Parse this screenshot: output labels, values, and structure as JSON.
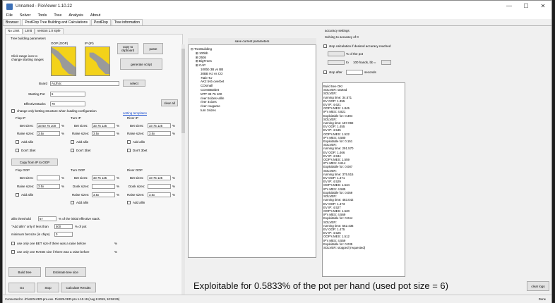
{
  "window": {
    "title": "Unnamed - PioViewer 1.10.22",
    "controls": [
      "—",
      "☐",
      "✕"
    ]
  },
  "menu": [
    "File",
    "Solver",
    "Tools",
    "Tree",
    "Analysis",
    "About"
  ],
  "main_tabs": [
    "Browser",
    "PostFlop Tree Building and Calculations",
    "PostFlop",
    "Tree information"
  ],
  "sub_tabs": [
    "No Limit",
    "Limit",
    "version 1.0 style"
  ],
  "left": {
    "section_title": "Tree building parameters",
    "oop_label": "OOP (OOP)",
    "ip_label": "IP (IP)",
    "range_hint": "Click range icon to change starting ranges",
    "copy_clipboard": "copy to clipboard",
    "paste": "paste",
    "generate_script": "generate script",
    "board_label": "Board",
    "board_value": "AsJh4c",
    "select": "select",
    "starting_pot_label": "Starting Pot",
    "starting_pot_value": "6",
    "eff_stacks_label": "EffectiveStacks",
    "eff_stacks_value": "70",
    "clear_all": "clear all",
    "change_only_label": "change only betting structure when loading configuration",
    "setting_templates": "setting templates",
    "flop_ip": "Flop IP",
    "turn_ip": "Turn IP",
    "river_ip": "River IP",
    "bet_sizes": "Bet sizes:",
    "raise_sizes": "Raise sizes:",
    "donk_sizes": "Donk sizes:",
    "flop_ip_bet": "33 50 75 100",
    "flop_ip_raise": "3.5x",
    "turn_ip_bet": "33 75 125",
    "turn_ip_raise": "3.5x",
    "river_ip_bet": "33 75 125",
    "river_ip_raise": "3.5x",
    "pct": "%",
    "add_allin": "Add allin",
    "dont_3bet": "Don't 3bet",
    "copy_ip_oop": "Copy from IP to OOP",
    "flop_oop": "Flop OOP",
    "turn_oop": "Turn OOP",
    "river_oop": "River OOP",
    "flop_oop_bet": "",
    "flop_oop_raise": "3.5x",
    "turn_oop_bet": "33 75 125",
    "turn_oop_donk": "",
    "turn_oop_raise": "3.5x",
    "river_oop_bet": "33 75 125",
    "river_oop_donk": "",
    "river_oop_raise": "3.5x",
    "allin_threshold_label": "allin threshold",
    "allin_threshold_value": "67",
    "allin_threshold_suffix": "% of the initial effective stack.",
    "add_allin_only_label": "\"Add allin\" only if less than",
    "add_allin_only_value": "500",
    "add_allin_only_suffix": "% of pot",
    "min_bet_label": "minimum bet size (in chips)",
    "min_bet_value": "0",
    "one_bet_label": "use only one BET size if there was a raise before",
    "one_raise_label": "use only one RAISE size if there was a raise before",
    "build_tree": "Build tree",
    "estimate_tree": "Estimate tree size",
    "go": "Go",
    "stop": "Stop",
    "calculate_results": "Calculate Results"
  },
  "tree": {
    "header": "save current parameters",
    "root": "TreeBuilding",
    "items": [
      "100bb",
      "25bb",
      "BigTrees",
      "CAP",
      "100bb 3B vs BB",
      "30BB HJ vs CO",
      "7tab HU",
      "AK2 bvb overbet",
      "COsmall",
      "COvsBB3bet",
      "MTT 33 75 100",
      "river 5sizes+allin",
      "river 4sizes",
      "river rougame",
      "turn 3sizes"
    ]
  },
  "right": {
    "accuracy_settings": "accuracy settings",
    "solving_to": "Solving to accuracy of 0",
    "stop_calc_label": "stop calculation if desired accuracy reached",
    "of_pot": "% of the pot",
    "to": "to",
    "mbb_label": "100 hands, bb =",
    "stop_after": "stop after",
    "seconds": "seconds",
    "log": [
      "Build tree OK!",
      "SOLVER: started",
      "SOLVER:",
      "running time: 34.571",
      "EV OOP: 1.355",
      "EV IP: 4.621",
      "OOP's MES: 1.845",
      "IP's MES: 4.821",
      "Exploitable for: 0.394",
      "SOLVER:",
      "running time: 187.092",
      "EV OOP: 1.455",
      "EV IP: 4.545",
      "OOP's MES: 1.522",
      "IP's MES: 4.580",
      "Exploitable for: 0.151",
      "SOLVER:",
      "running time: 291.570",
      "EV OOP: 1.466",
      "EV IP: 4.534",
      "OOP's MES: 1.559",
      "IP's MES: 4.614",
      "Exploitable for: 0.087",
      "SOLVER:",
      "running time: 375.515",
      "EV OOP: 1.471",
      "EV IP: 4.529",
      "OOP's MES: 1.534",
      "IP's MES: 4.585",
      "Exploitable for: 0.059",
      "SOLVER:",
      "running time: 483.042",
      "EV OOP: 1.473",
      "EV IP: 4.527",
      "OOP's MES: 1.520",
      "IP's MES: 4.569",
      "Exploitable for: 0.044",
      "SOLVER:",
      "running time: 562.436",
      "EV OOP: 1.475",
      "EV IP: 4.525",
      "OOP's MES: 1.512",
      "IP's MES: 4.559",
      "Exploitable for: 0.035",
      "SOLVER: stopped (requested)"
    ]
  },
  "bottom": {
    "exploitable_text": "Exploitable for 0.5833% of the pot per hand (used pot size = 6)",
    "clear_logs": "clear logs",
    "status": "Connected to .\\PioSOLVER-pro.exe. PioSOLVER-pro 1.10.19 (Aug  8 2019, 10:58:25)",
    "done": "Done"
  },
  "colors": {
    "range_yellow": "#f3d21a",
    "range_gray": "#9a9a9a"
  }
}
